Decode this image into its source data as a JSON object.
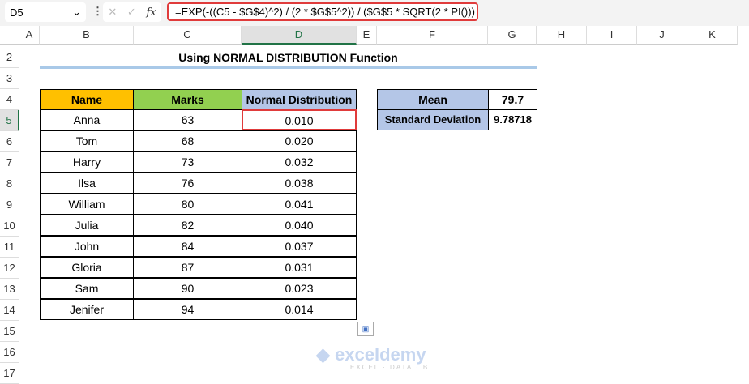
{
  "name_box": "D5",
  "formula": "=EXP(-((C5 - $G$4)^2) / (2 * $G$5^2)) / ($G$5 * SQRT(2 * PI()))",
  "fx_label": "fx",
  "columns": [
    "A",
    "B",
    "C",
    "D",
    "E",
    "F",
    "G",
    "H",
    "I",
    "J",
    "K"
  ],
  "rows": [
    "2",
    "3",
    "4",
    "5",
    "6",
    "7",
    "8",
    "9",
    "10",
    "11",
    "12",
    "13",
    "14",
    "15",
    "16",
    "17"
  ],
  "title": "Using NORMAL DISTRIBUTION Function",
  "headers": {
    "name": "Name",
    "marks": "Marks",
    "nd": "Normal Distribution"
  },
  "data": [
    {
      "name": "Anna",
      "marks": "63",
      "nd": "0.010"
    },
    {
      "name": "Tom",
      "marks": "68",
      "nd": "0.020"
    },
    {
      "name": "Harry",
      "marks": "73",
      "nd": "0.032"
    },
    {
      "name": "Ilsa",
      "marks": "76",
      "nd": "0.038"
    },
    {
      "name": "William",
      "marks": "80",
      "nd": "0.041"
    },
    {
      "name": "Julia",
      "marks": "82",
      "nd": "0.040"
    },
    {
      "name": "John",
      "marks": "84",
      "nd": "0.037"
    },
    {
      "name": "Gloria",
      "marks": "87",
      "nd": "0.031"
    },
    {
      "name": "Sam",
      "marks": "90",
      "nd": "0.023"
    },
    {
      "name": "Jenifer",
      "marks": "94",
      "nd": "0.014"
    }
  ],
  "stats": {
    "mean_label": "Mean",
    "mean": "79.7",
    "sd_label": "Standard Deviation",
    "sd": "9.78718"
  },
  "watermark": {
    "brand": "exceldemy",
    "tagline": "EXCEL · DATA · BI"
  },
  "colors": {
    "name_header": "#ffc000",
    "marks_header": "#92d050",
    "nd_header": "#b4c6e7",
    "selection": "#e03b3b"
  }
}
